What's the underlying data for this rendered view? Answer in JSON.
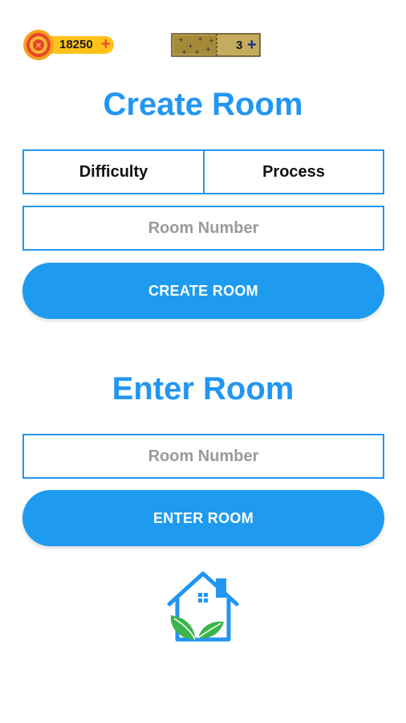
{
  "header": {
    "coins": "18250",
    "coin_plus": "+",
    "tickets": "3",
    "ticket_plus": "+"
  },
  "create_section": {
    "title": "Create Room",
    "difficulty_label": "Difficulty",
    "process_label": "Process",
    "room_number_placeholder": "Room Number",
    "button_label": "CREATE ROOM"
  },
  "enter_section": {
    "title": "Enter Room",
    "room_number_placeholder": "Room Number",
    "button_label": "ENTER ROOM"
  },
  "colors": {
    "accent": "#2196f3",
    "button": "#1e9bef",
    "coin_gold": "#ffc21a",
    "leaf_green": "#3cb44b"
  },
  "icons": {
    "coin": "coin-icon",
    "ticket": "ticket-icon",
    "home_logo": "home-leaf-icon"
  }
}
